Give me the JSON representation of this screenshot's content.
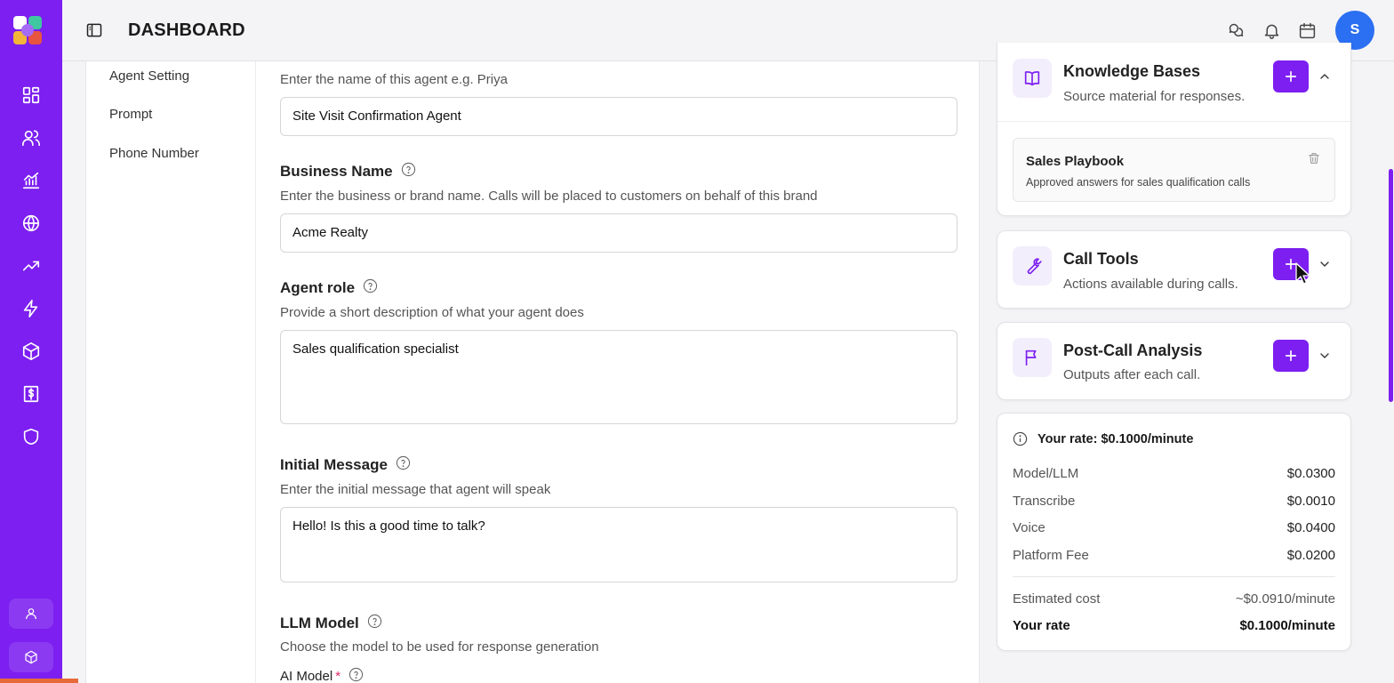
{
  "header": {
    "title": "DASHBOARD",
    "avatar_initial": "S"
  },
  "sidebar": {
    "icons": [
      "dashboard-icon",
      "users-icon",
      "analytics-icon",
      "globe-icon",
      "trending-icon",
      "bolt-icon",
      "package-icon",
      "billing-icon",
      "shield-icon"
    ],
    "bottom": [
      "profile-icon",
      "package-icon"
    ]
  },
  "subnav": {
    "items": [
      "Agent Setting",
      "Prompt",
      "Phone Number"
    ]
  },
  "form": {
    "agent_name_hint": "Enter the name of this agent e.g. Priya",
    "agent_name_value": "Site Visit Confirmation Agent",
    "business_label": "Business Name",
    "business_hint": "Enter the business or brand name. Calls will be placed to customers on behalf of this brand",
    "business_value": "Acme Realty",
    "role_label": "Agent role",
    "role_hint": "Provide a short description of what your agent does",
    "role_value": "Sales qualification specialist",
    "initial_label": "Initial Message",
    "initial_hint": "Enter the initial message that agent will speak",
    "initial_value": "Hello! Is this a good time to talk?",
    "llm_label": "LLM Model",
    "llm_hint": "Choose the model to be used for response generation",
    "ai_model_label": "AI Model",
    "required_mark": "*"
  },
  "knowledge": {
    "title": "Knowledge Bases",
    "subtitle": "Source material for responses.",
    "item_name": "Sales Playbook",
    "item_desc": "Approved answers for sales qualification calls"
  },
  "tools": {
    "title": "Call Tools",
    "subtitle": "Actions available during calls."
  },
  "analysis": {
    "title": "Post-Call Analysis",
    "subtitle": "Outputs after each call."
  },
  "rate": {
    "header": "Your rate: $0.1000/minute",
    "rows": [
      {
        "label": "Model/LLM",
        "value": "$0.0300"
      },
      {
        "label": "Transcribe",
        "value": "$0.0010"
      },
      {
        "label": "Voice",
        "value": "$0.0400"
      },
      {
        "label": "Platform Fee",
        "value": "$0.0200"
      }
    ],
    "estimated_label": "Estimated cost",
    "estimated_value": "~$0.0910/minute",
    "your_rate_label": "Your rate",
    "your_rate_value": "$0.1000/minute"
  },
  "colors": {
    "brand": "#7c1ff0",
    "avatar": "#2b6ff2"
  }
}
